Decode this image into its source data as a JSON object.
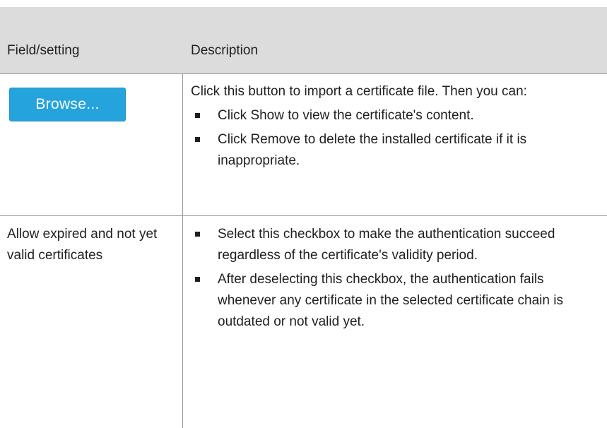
{
  "header": {
    "col1": "Field/setting",
    "col2": "Description"
  },
  "rows": [
    {
      "button_label": "Browse...",
      "intro": "Click this button to import a certificate file. Then you can:",
      "bullets": [
        "Click Show to view the certificate's content.",
        "Click Remove to delete the installed certificate if it is inappropriate."
      ]
    },
    {
      "label": "Allow expired and not yet valid certificates",
      "bullets": [
        "Select this checkbox to make the authentication succeed regardless of the certificate's validity period.",
        "After deselecting this checkbox, the authentication fails whenever any certificate in the selected certificate chain is outdated or not valid yet."
      ]
    }
  ]
}
